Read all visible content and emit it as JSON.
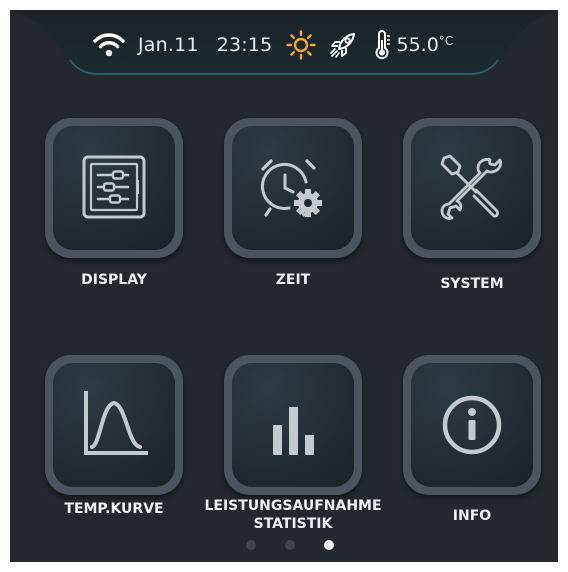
{
  "status": {
    "date": "Jan.11",
    "time": "23:15",
    "temperature": "55.0",
    "temperature_unit": "°C",
    "icons": [
      "wifi-icon",
      "sun-icon",
      "rocket-icon",
      "thermometer-icon"
    ],
    "sun_color": "#f3a53a"
  },
  "menu": {
    "items": [
      {
        "label": "DISPLAY",
        "icon": "display-settings-icon"
      },
      {
        "label": "ZEIT",
        "icon": "alarm-clock-gear-icon"
      },
      {
        "label": "SYSTEM",
        "icon": "tools-icon"
      },
      {
        "label": "TEMP.KURVE",
        "icon": "temperature-curve-icon"
      },
      {
        "label": "LEISTUNGSAUFNAHME",
        "label2": "STATISTIK",
        "icon": "bar-chart-icon"
      },
      {
        "label": "INFO",
        "icon": "info-icon"
      }
    ]
  },
  "pagination": {
    "pages": 3,
    "current": 3
  }
}
